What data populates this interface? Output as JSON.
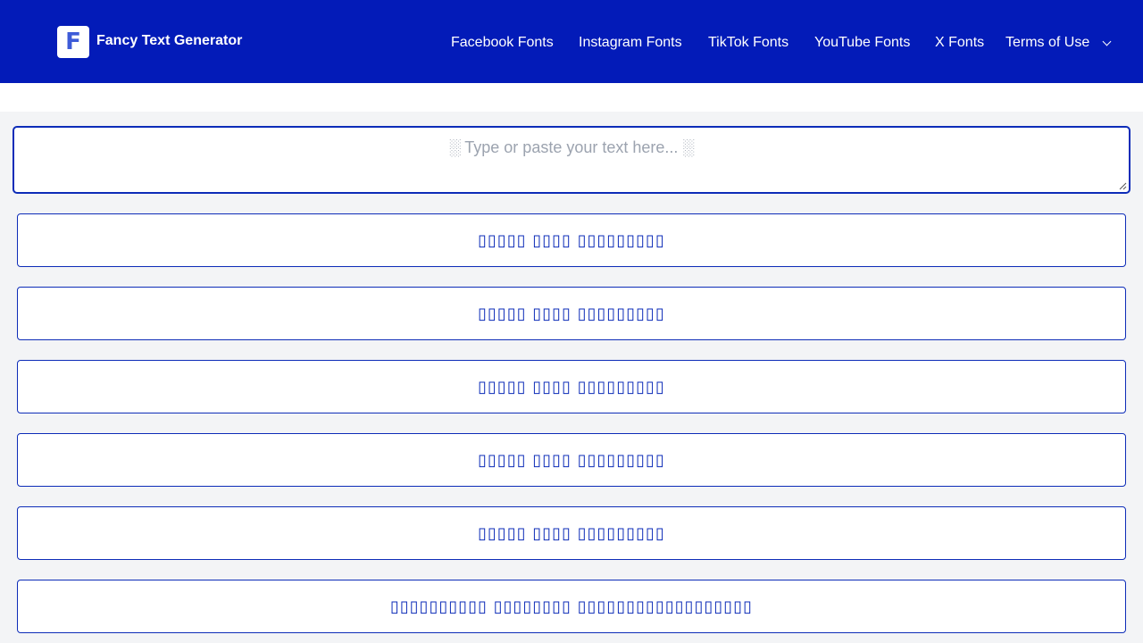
{
  "header": {
    "logo_letter": "F",
    "brand": "Fancy Text Generator",
    "nav": [
      {
        "label": "Facebook Fonts"
      },
      {
        "label": "Instagram Fonts"
      },
      {
        "label": "TikTok Fonts"
      },
      {
        "label": "YouTube Fonts"
      },
      {
        "label": "X Fonts"
      },
      {
        "label": "Terms of Use"
      }
    ],
    "dropdown_icon": "chevron-down-icon"
  },
  "generator": {
    "placeholder": "░ Type or paste your text here... ░"
  },
  "results": [
    {
      "text": "▯▯▯▯▯ ▯▯▯▯ ▯▯▯▯▯▯▯▯▯"
    },
    {
      "text": "▯▯▯▯▯ ▯▯▯▯ ▯▯▯▯▯▯▯▯▯"
    },
    {
      "text": "▯▯▯▯▯ ▯▯▯▯ ▯▯▯▯▯▯▯▯▯"
    },
    {
      "text": "▯▯▯▯▯ ▯▯▯▯ ▯▯▯▯▯▯▯▯▯"
    },
    {
      "text": "▯▯▯▯▯ ▯▯▯▯ ▯▯▯▯▯▯▯▯▯"
    },
    {
      "text": "▯▯▯▯▯▯▯▯▯▯ ▯▯▯▯▯▯▯▯ ▯▯▯▯▯▯▯▯▯▯▯▯▯▯▯▯▯▯"
    }
  ],
  "colors": {
    "header_bg": "#031bb8",
    "accent": "#0d2cb8",
    "page_bg": "#f3f4f6",
    "placeholder": "#9ca3af"
  }
}
